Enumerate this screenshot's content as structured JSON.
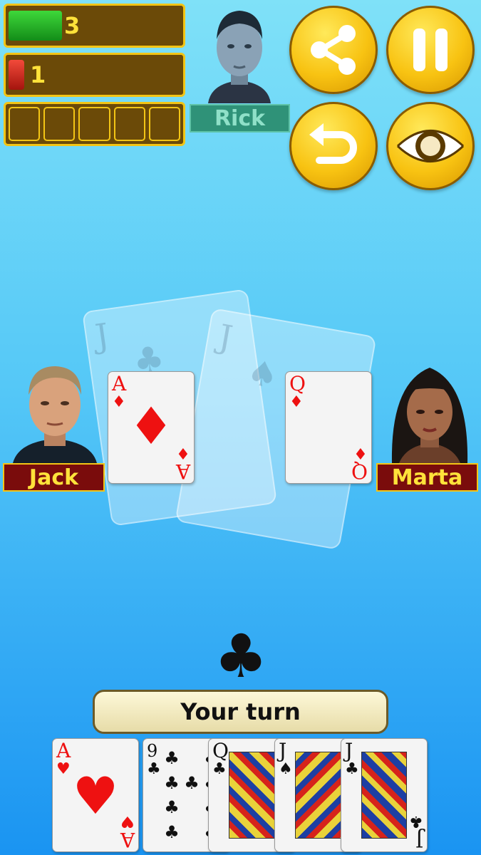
{
  "scores": {
    "player_green": {
      "value": "3",
      "fill_fraction": 0.3,
      "color": "#1fa524"
    },
    "player_red": {
      "value": "1",
      "fill_fraction": 0.08,
      "color": "#d8261c"
    },
    "tricks_slots": 5
  },
  "opponents": {
    "top": {
      "name": "Rick",
      "active": false
    },
    "left": {
      "name": "Jack"
    },
    "right": {
      "name": "Marta"
    }
  },
  "buttons": {
    "share": {
      "icon": "share-icon"
    },
    "pause": {
      "icon": "pause-icon"
    },
    "undo": {
      "icon": "undo-icon"
    },
    "view": {
      "icon": "eye-icon"
    }
  },
  "table": {
    "played": {
      "left": {
        "rank": "A",
        "suit": "♦"
      },
      "right": {
        "rank": "Q",
        "suit": "♦"
      }
    },
    "ghost_cards": [
      {
        "rank": "J",
        "suit": "♣"
      },
      {
        "rank": "J",
        "suit": "♠"
      }
    ]
  },
  "trump": {
    "suit": "♣"
  },
  "status": {
    "text": "Your turn"
  },
  "hand": [
    {
      "rank": "A",
      "suit": "♥"
    },
    {
      "rank": "9",
      "suit": "♣"
    },
    {
      "rank": "Q",
      "suit": "♣"
    },
    {
      "rank": "J",
      "suit": "♠"
    },
    {
      "rank": "J",
      "suit": "♣"
    }
  ],
  "colors": {
    "gold": "#f3c515",
    "bar_bg": "#6b4a08",
    "score_text": "#ffe23a",
    "name_red_bg": "#7a0c0c"
  }
}
